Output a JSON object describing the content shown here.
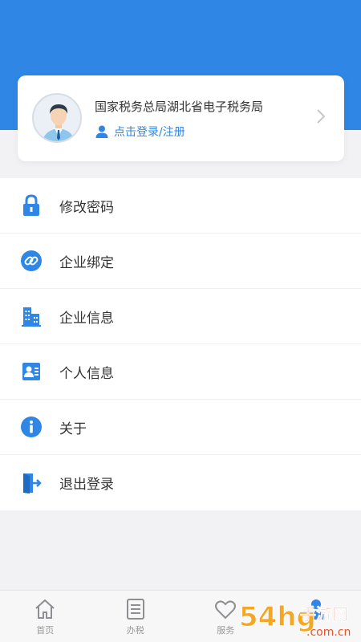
{
  "header": {
    "bg_color": "#2f86e4"
  },
  "profile": {
    "org_name": "国家税务总局湖北省电子税务局",
    "login_text": "点击登录/注册",
    "avatar_icon": "avatar-icon",
    "chevron_icon": "chevron-right-icon"
  },
  "menu": {
    "items": [
      {
        "label": "修改密码",
        "icon": "lock-icon"
      },
      {
        "label": "企业绑定",
        "icon": "link-icon"
      },
      {
        "label": "企业信息",
        "icon": "building-icon"
      },
      {
        "label": "个人信息",
        "icon": "id-card-icon"
      },
      {
        "label": "关于",
        "icon": "info-icon"
      },
      {
        "label": "退出登录",
        "icon": "logout-icon"
      }
    ]
  },
  "tabbar": {
    "tabs": [
      {
        "label": "首页",
        "icon": "home-icon"
      },
      {
        "label": "办税",
        "icon": "list-icon"
      },
      {
        "label": "服务",
        "icon": "heart-icon"
      },
      {
        "label": "",
        "icon": "person-icon"
      }
    ]
  },
  "watermark": {
    "text": "54hg手游网",
    "subtext": ".com.cn"
  },
  "colors": {
    "accent": "#2f86e4",
    "background": "#f2f2f4"
  }
}
